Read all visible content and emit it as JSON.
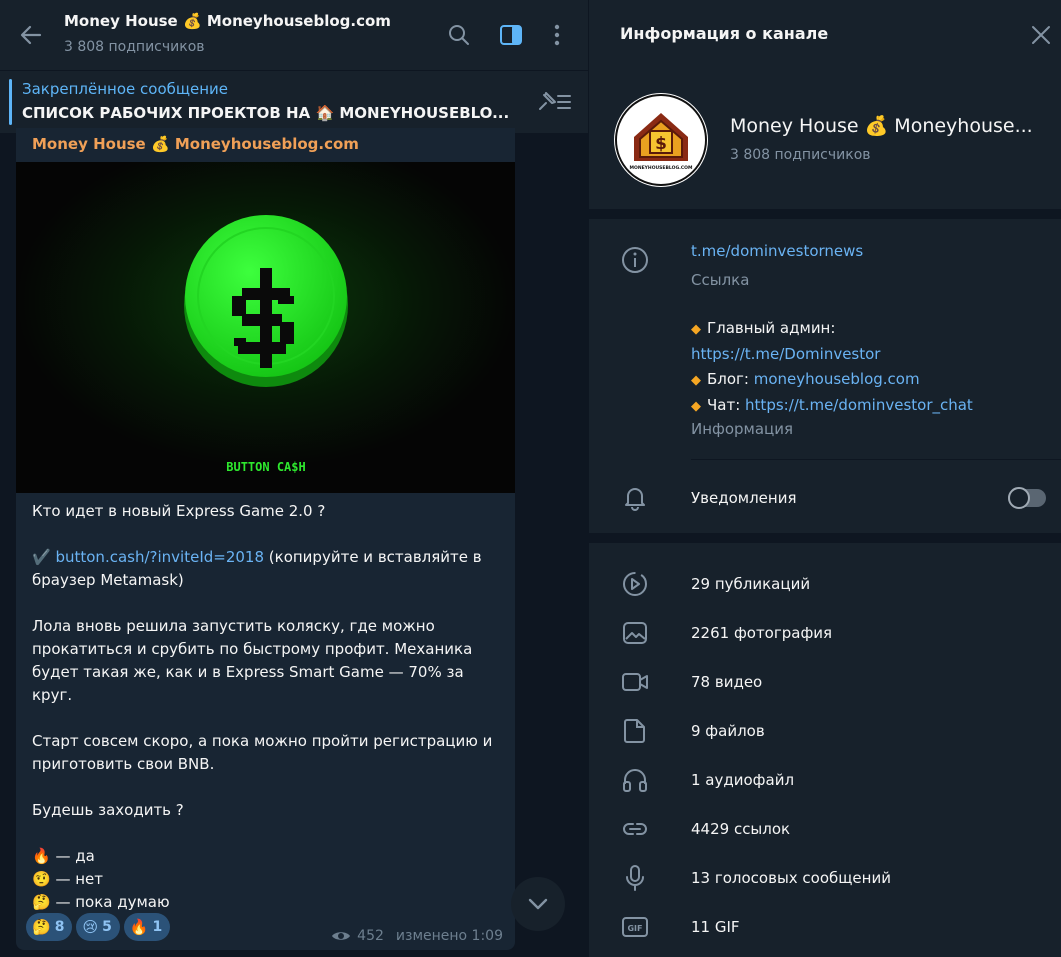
{
  "chat": {
    "title": "Money House 💰 Moneyhouseblog.com",
    "subscribers": "3 808 подписчиков",
    "pinned_label": "Закреплённое сообщение",
    "pinned_text": "СПИСОК РАБОЧИХ ПРОЕКТОВ НА 🏠 MONEYHOUSEBLO..."
  },
  "message": {
    "author": "Money House 💰 Moneyhouseblog.com",
    "media_caption": "BUTTON CA$H",
    "line1": "Кто идет в новый Express Game 2.0 ?",
    "link_emoji": "✔️",
    "link": "button.cash/?inviteId=2018",
    "link_suffix": " (копируйте и вставляйте в браузер Metamask)",
    "para2": "Лола вновь решила запустить коляску, где можно прокатиться и срубить по быстрому профит. Механика будет такая же, как и в Express Smart Game — 70% за круг.",
    "para3": "Старт совсем скоро, а пока можно пройти регистрацию и приготовить свои BNB.",
    "para4": "Будешь заходить ?",
    "poll": [
      {
        "emoji": "🔥",
        "text": " — да"
      },
      {
        "emoji": "🤨",
        "text": " — нет"
      },
      {
        "emoji": "🤔",
        "text": " — пока думаю"
      }
    ],
    "reactions": [
      {
        "emoji": "🤔",
        "count": "8"
      },
      {
        "emoji": "😢",
        "count": "5"
      },
      {
        "emoji": "🔥",
        "count": "1"
      }
    ],
    "views": "452",
    "edited": "изменено 1:09"
  },
  "info": {
    "title": "Информация о канале",
    "name": "Money House 💰 Moneyhouse...",
    "subscribers": "3 808 подписчиков",
    "avatar_text": "MONEYHOUSEBLOG.COM",
    "link": "t.me/dominvestornews",
    "link_caption": "Ссылка",
    "desc": {
      "admin_label": "Главный админ:",
      "admin_link": "https://t.me/Dominvestor",
      "blog_label": "Блог: ",
      "blog_link": "moneyhouseblog.com",
      "chat_label": "Чат: ",
      "chat_link": "https://t.me/dominvestor_chat"
    },
    "desc_caption": "Информация",
    "notifications": "Уведомления",
    "notifications_on": false,
    "stats": [
      {
        "icon": "publications-icon",
        "label": "29 публикаций"
      },
      {
        "icon": "photo-icon",
        "label": "2261 фотография"
      },
      {
        "icon": "video-icon",
        "label": "78 видео"
      },
      {
        "icon": "file-icon",
        "label": "9 файлов"
      },
      {
        "icon": "headphones-icon",
        "label": "1 аудиофайл"
      },
      {
        "icon": "link-icon",
        "label": "4429 ссылок"
      },
      {
        "icon": "microphone-icon",
        "label": "13 голосовых сообщений"
      },
      {
        "icon": "gif-icon",
        "label": "11 GIF"
      }
    ]
  },
  "colors": {
    "accent": "#5eb5f7",
    "link": "#6ab3f3",
    "author": "#f0a057",
    "panel": "#17212b",
    "background": "#0e1621",
    "bubble": "#182533",
    "coin_green": "#1ee81e"
  }
}
